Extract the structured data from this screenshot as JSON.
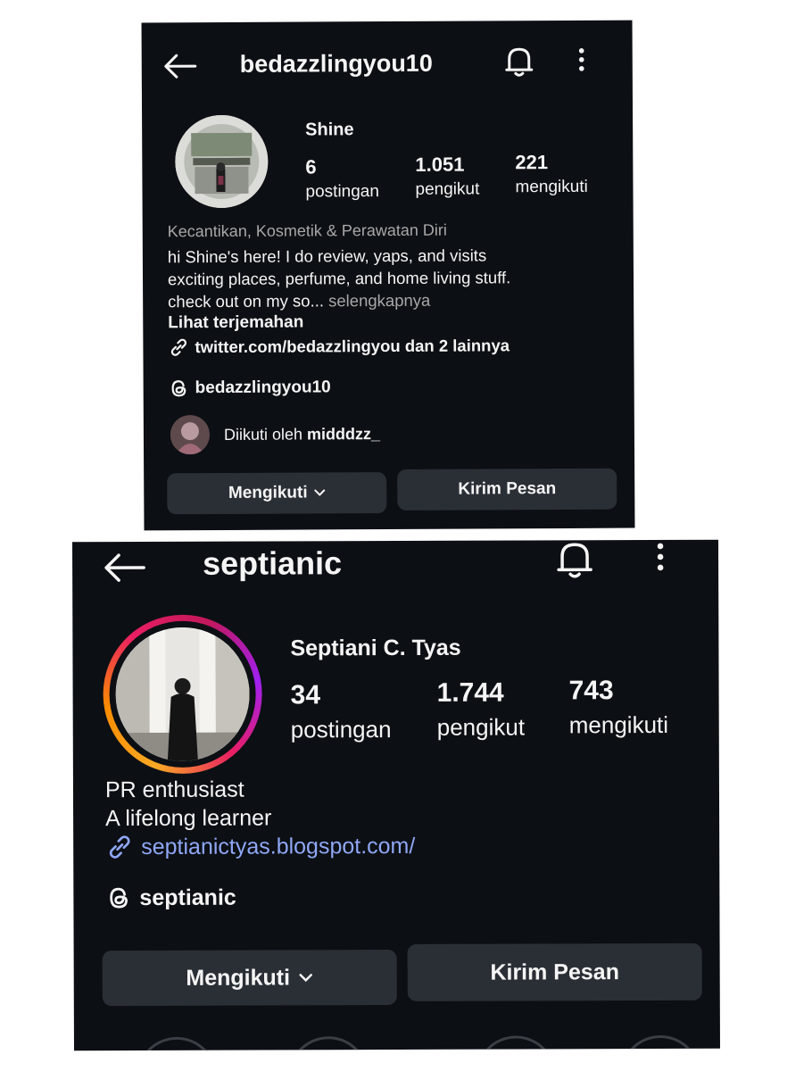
{
  "profile1": {
    "username": "bedazzlingyou10",
    "display_name": "Shine",
    "stats": [
      {
        "value": "6",
        "label": "postingan"
      },
      {
        "value": "1.051",
        "label": "pengikut"
      },
      {
        "value": "221",
        "label": "mengikuti"
      }
    ],
    "category": "Kecantikan, Kosmetik & Perawatan Diri",
    "bio_line1": "hi Shine's here! I do review, yaps, and visits",
    "bio_line2": "exciting places, perfume, and home living stuff.",
    "bio_line3": "check out on my so...",
    "more_label": "selengkapnya",
    "translate_label": "Lihat terjemahan",
    "link_text": "twitter.com/bedazzlingyou dan 2 lainnya",
    "threads_handle": "bedazzlingyou10",
    "followed_by_prefix": "Diikuti oleh",
    "followed_by_user": "midddzz_",
    "follow_button": "Mengikuti",
    "message_button": "Kirim Pesan",
    "icons": [
      "back-arrow-icon",
      "bell-icon",
      "more-vertical-icon",
      "link-icon",
      "threads-icon",
      "chevron-down-icon"
    ]
  },
  "profile2": {
    "username": "septianic",
    "display_name": "Septiani C. Tyas",
    "stats": [
      {
        "value": "34",
        "label": "postingan"
      },
      {
        "value": "1.744",
        "label": "pengikut"
      },
      {
        "value": "743",
        "label": "mengikuti"
      }
    ],
    "bio_line1": "PR enthusiast",
    "bio_line2": "A lifelong learner",
    "link_text": "septianictyas.blogspot.com/",
    "threads_handle": "septianic",
    "follow_button": "Mengikuti",
    "message_button": "Kirim Pesan",
    "story_ring_colors": [
      "#f9a825",
      "#e91e63",
      "#c2185b",
      "#a020f0"
    ],
    "link_color": "#8fa7f5",
    "icons": [
      "back-arrow-icon",
      "bell-icon",
      "more-vertical-icon",
      "link-icon",
      "threads-icon",
      "chevron-down-icon"
    ]
  }
}
